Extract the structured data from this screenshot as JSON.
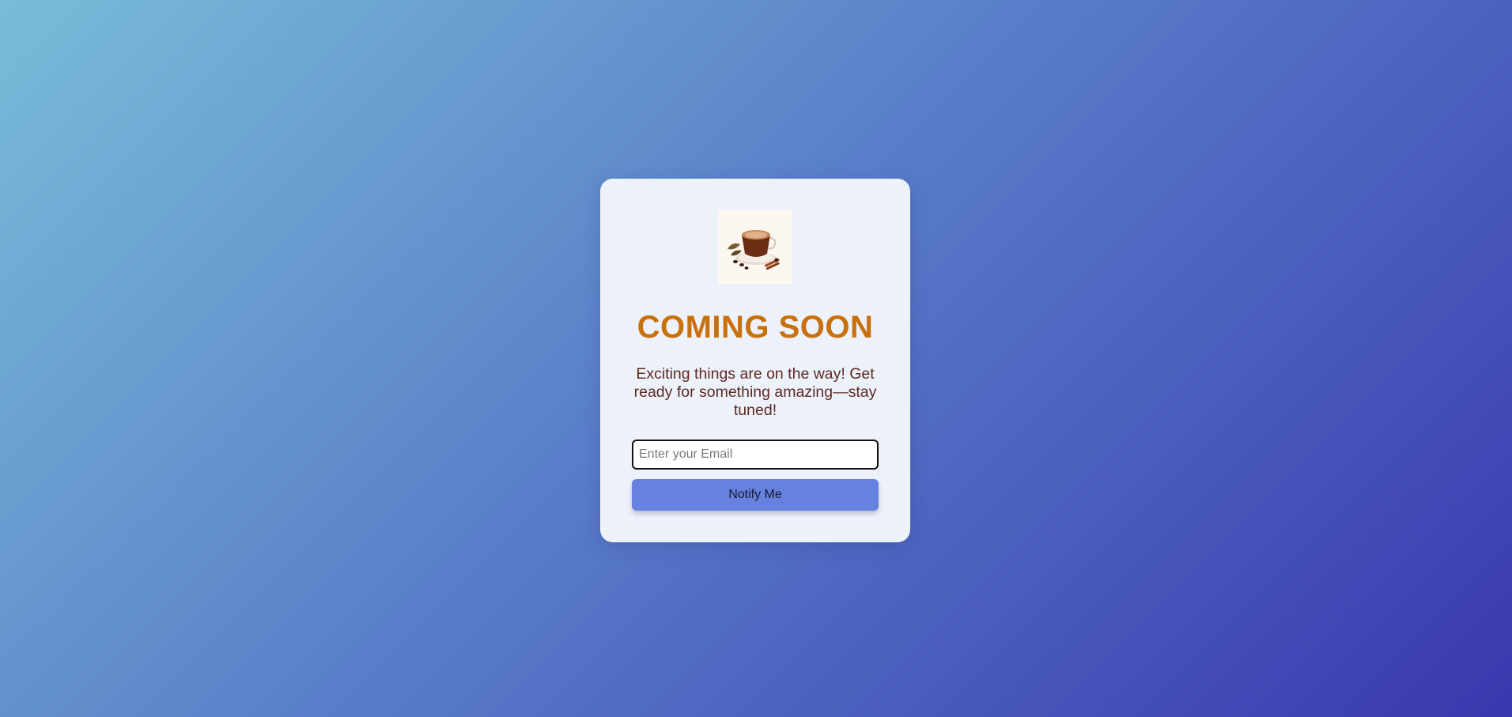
{
  "card": {
    "logo_icon": "coffee-cup-icon",
    "title": "COMING SOON",
    "subtitle": "Exciting things are on the way! Get ready for something amazing—stay tuned!",
    "email_placeholder": "Enter your Email",
    "email_value": "",
    "button_label": "Notify Me"
  },
  "colors": {
    "title": "#c8700c",
    "subtitle": "#5e2a22",
    "button": "#6682de",
    "card_background": "#edf1fa",
    "background_start": "#78bcd9",
    "background_end": "#3a37ae"
  }
}
